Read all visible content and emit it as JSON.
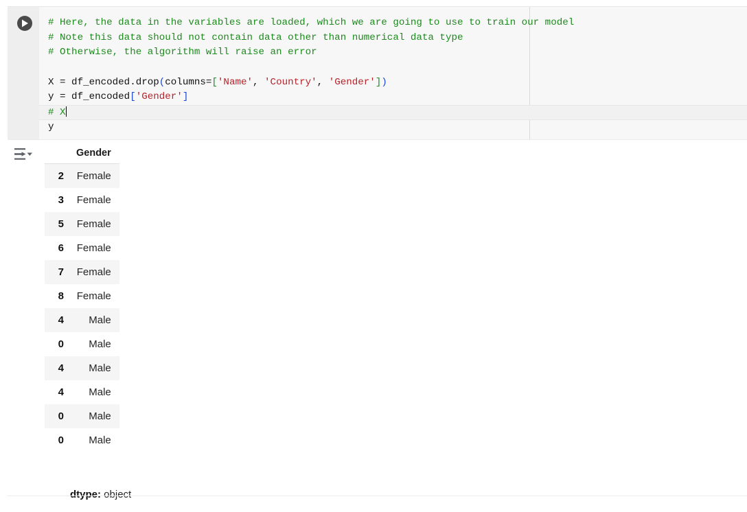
{
  "cell": {
    "run_button_label": "Run cell",
    "run_icon": "play-icon",
    "output_actions_icon": "output-actions-filter-icon"
  },
  "code": {
    "lines": [
      {
        "id": "line1",
        "tokens": [
          {
            "t": "comment",
            "s": "# Here, the data in the variables are loaded, which we are going to use to train our model"
          }
        ]
      },
      {
        "id": "line2",
        "tokens": [
          {
            "t": "comment",
            "s": "# Note this data should not contain data other than numerical data type"
          }
        ]
      },
      {
        "id": "line3",
        "tokens": [
          {
            "t": "comment",
            "s": "# Otherwise, the algorithm will raise an error"
          }
        ]
      },
      {
        "id": "line4",
        "tokens": [
          {
            "t": "plain",
            "s": ""
          }
        ]
      },
      {
        "id": "line5",
        "tokens": [
          {
            "t": "plain",
            "s": "X = df_encoded.drop"
          },
          {
            "t": "paren-b",
            "s": "("
          },
          {
            "t": "plain",
            "s": "columns="
          },
          {
            "t": "paren-g",
            "s": "["
          },
          {
            "t": "str",
            "s": "'Name'"
          },
          {
            "t": "plain",
            "s": ", "
          },
          {
            "t": "str",
            "s": "'Country'"
          },
          {
            "t": "plain",
            "s": ", "
          },
          {
            "t": "str",
            "s": "'Gender'"
          },
          {
            "t": "paren-g",
            "s": "]"
          },
          {
            "t": "paren-b",
            "s": ")"
          }
        ]
      },
      {
        "id": "line6",
        "tokens": [
          {
            "t": "plain",
            "s": "y = df_encoded"
          },
          {
            "t": "paren-b",
            "s": "["
          },
          {
            "t": "str",
            "s": "'Gender'"
          },
          {
            "t": "paren-b",
            "s": "]"
          }
        ]
      },
      {
        "id": "line7",
        "active": true,
        "caret": true,
        "tokens": [
          {
            "t": "comment",
            "s": "# X"
          }
        ]
      },
      {
        "id": "line8",
        "tokens": [
          {
            "t": "plain",
            "s": "y"
          }
        ]
      }
    ]
  },
  "output": {
    "column_header": "Gender",
    "rows": [
      {
        "index": "2",
        "value": "Female"
      },
      {
        "index": "3",
        "value": "Female"
      },
      {
        "index": "5",
        "value": "Female"
      },
      {
        "index": "6",
        "value": "Female"
      },
      {
        "index": "7",
        "value": "Female"
      },
      {
        "index": "8",
        "value": "Female"
      },
      {
        "index": "4",
        "value": "Male"
      },
      {
        "index": "0",
        "value": "Male"
      },
      {
        "index": "4",
        "value": "Male"
      },
      {
        "index": "4",
        "value": "Male"
      },
      {
        "index": "0",
        "value": "Male"
      },
      {
        "index": "0",
        "value": "Male"
      }
    ],
    "dtype_label": "dtype:",
    "dtype_value": " object"
  },
  "colors": {
    "comment": "#1e8a1e",
    "string": "#b5232b",
    "bracket_blue": "#1a46d0",
    "bracket_green": "#1a8f28",
    "code_bg": "#f7f7f7",
    "gutter_bg": "#eeeeee",
    "row_stripe": "#f5f5f5"
  }
}
